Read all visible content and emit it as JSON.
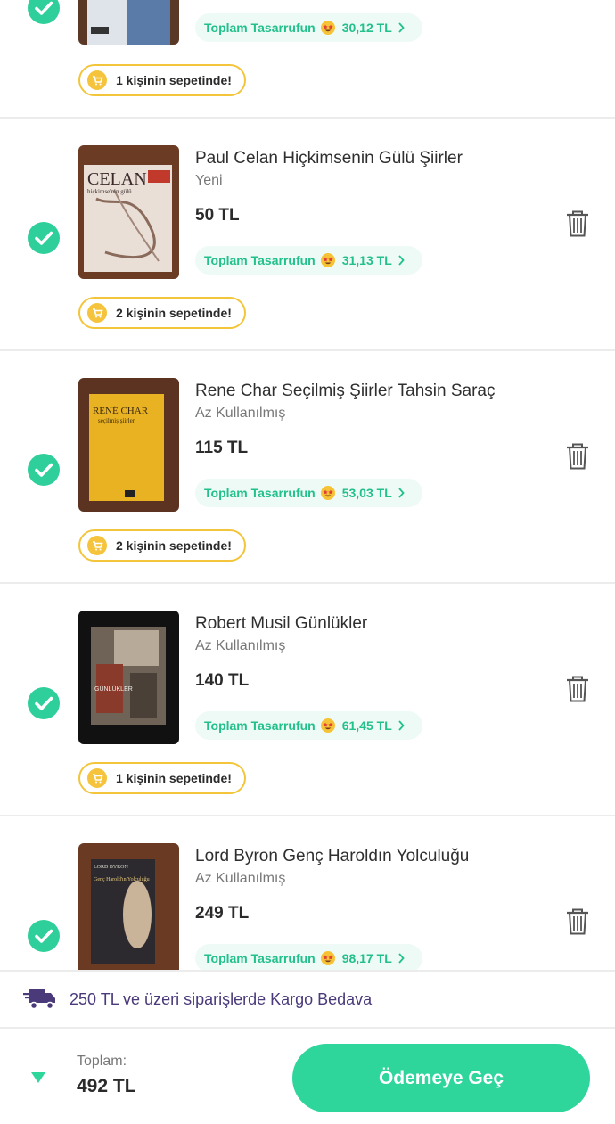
{
  "items": [
    {
      "title": "",
      "condition": "",
      "price": "",
      "saving_label": "Toplam Tasarrufun",
      "saving_amount": "30,12 TL",
      "cart_count_text": "1 kişinin sepetinde!"
    },
    {
      "title": "Paul Celan Hiçkimsenin Gülü Şiirler",
      "condition": "Yeni",
      "price": "50 TL",
      "saving_label": "Toplam Tasarrufun",
      "saving_amount": "31,13 TL",
      "cart_count_text": "2 kişinin sepetinde!",
      "cover_title": "CELAN",
      "cover_subtitle": "hiçkimse'nin gülü"
    },
    {
      "title": "Rene Char Seçilmiş Şiirler Tahsin Saraç",
      "condition": "Az Kullanılmış",
      "price": "115 TL",
      "saving_label": "Toplam Tasarrufun",
      "saving_amount": "53,03 TL",
      "cart_count_text": "2 kişinin sepetinde!",
      "cover_title": "RENÉ CHAR",
      "cover_subtitle": "seçilmiş şiirler"
    },
    {
      "title": "Robert Musil Günlükler",
      "condition": "Az Kullanılmış",
      "price": "140 TL",
      "saving_label": "Toplam Tasarrufun",
      "saving_amount": "61,45 TL",
      "cart_count_text": "1 kişinin sepetinde!",
      "cover_title": "GÜNLÜKLER"
    },
    {
      "title": "Lord Byron Genç Haroldın Yolculuğu",
      "condition": "Az Kullanılmış",
      "price": "249 TL",
      "saving_label": "Toplam Tasarrufun",
      "saving_amount": "98,17 TL",
      "cover_title": "LORD BYRON",
      "cover_subtitle": "Genç Harold'ın Yolculuğu"
    }
  ],
  "shipping_notice": "250 TL ve üzeri siparişlerde Kargo Bedava",
  "footer": {
    "total_label": "Toplam:",
    "total_value": "492 TL",
    "checkout_label": "Ödemeye Geç"
  },
  "colors": {
    "accent": "#2ed69c",
    "saving_text": "#22c08b",
    "badge_border": "#f3c53a",
    "shipping_text": "#4a3a7a"
  },
  "icons": {
    "check": "check-circle-icon",
    "trash": "trash-icon",
    "cart": "cart-icon",
    "truck": "truck-icon",
    "chevron": "chevron-right-icon",
    "collapse": "triangle-down-icon",
    "emoji": "star-eyes-emoji-icon"
  }
}
